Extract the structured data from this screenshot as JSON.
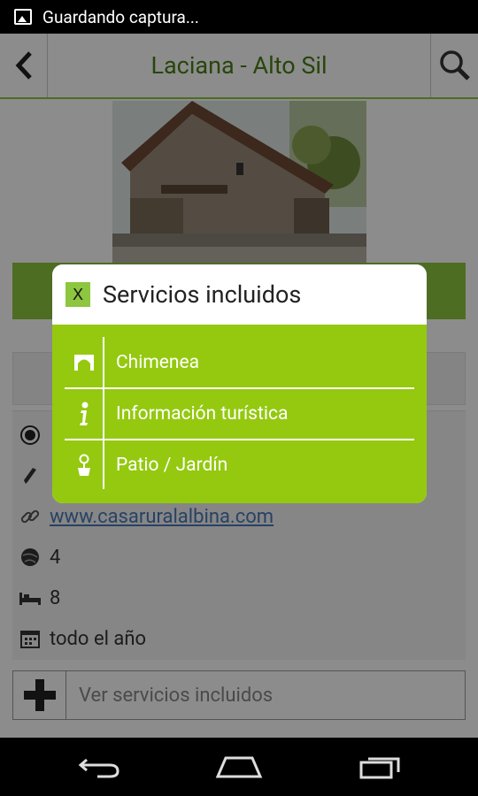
{
  "status_bar": {
    "text": "Guardando captura..."
  },
  "header": {
    "title": "Laciana - Alto Sil"
  },
  "info_rows": [
    {
      "icon": "radio-icon",
      "value": ""
    },
    {
      "icon": "pencil-icon",
      "value": ""
    },
    {
      "icon": "link-icon",
      "value": "www.casaruralalbina.com"
    },
    {
      "icon": "globe-icon",
      "value": "4"
    },
    {
      "icon": "bed-icon",
      "value": "8"
    },
    {
      "icon": "calendar-icon",
      "value": "todo el año"
    }
  ],
  "footer_button": {
    "label": "Ver servicios incluidos"
  },
  "dialog": {
    "close_label": "X",
    "title": "Servicios incluidos",
    "items": [
      {
        "icon": "fireplace-icon",
        "label": "Chimenea"
      },
      {
        "icon": "info-icon",
        "label": "Información turística"
      },
      {
        "icon": "garden-icon",
        "label": "Patio / Jardín"
      }
    ]
  },
  "colors": {
    "accent": "#8dc63f",
    "dialog_body": "#94c910",
    "title": "#4a7e16",
    "link": "#4a78b6"
  }
}
